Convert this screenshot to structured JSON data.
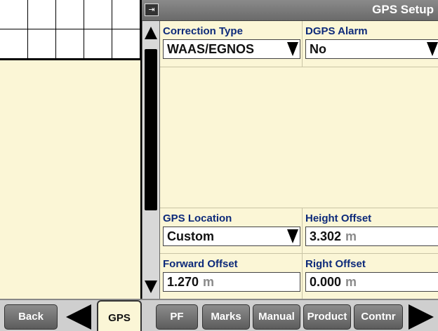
{
  "title_bar": {
    "title": "GPS Setup",
    "icon": "gps-setup-icon"
  },
  "fields": {
    "correction_type": {
      "label": "Correction Type",
      "value": "WAAS/EGNOS"
    },
    "dgps_alarm": {
      "label": "DGPS Alarm",
      "value": "No"
    },
    "gps_location": {
      "label": "GPS Location",
      "value": "Custom"
    },
    "height_offset": {
      "label": "Height Offset",
      "value": "3.302",
      "unit": "m"
    },
    "forward_offset": {
      "label": "Forward Offset",
      "value": "1.270",
      "unit": "m"
    },
    "right_offset": {
      "label": "Right Offset",
      "value": "0.000",
      "unit": "m"
    }
  },
  "bottom_bar": {
    "back": "Back",
    "gps": "GPS",
    "pf": "PF",
    "marks": "Marks",
    "manual": "Manual",
    "product": "Product",
    "contnr": "Contnr"
  },
  "colors": {
    "background": "#fbf6d6",
    "label_blue": "#0d2a7a",
    "title_bar": "#7a7a7a",
    "unit_gray": "#8a8a8a"
  }
}
